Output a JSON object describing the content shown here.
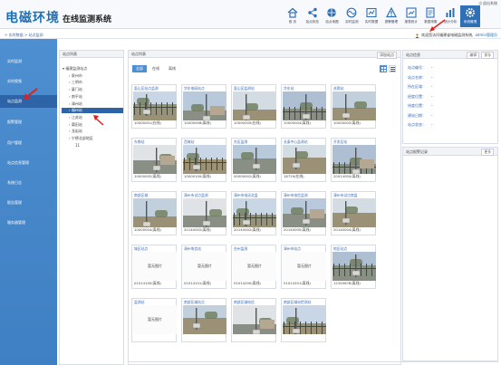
{
  "app": {
    "logo": "电磁环境",
    "logo_sub": "在线监测系统",
    "top_link": "退出系统",
    "breadcrumb": "> 实时数据 > 站点监测",
    "welcome": "欢迎您访问福建省电磁监测系统,",
    "username": "admin管理员"
  },
  "toolbar": [
    {
      "label": "首 页",
      "icon": "home-icon"
    },
    {
      "label": "站点状态",
      "icon": "share-icon"
    },
    {
      "label": "站点地图",
      "icon": "globe-icon"
    },
    {
      "label": "实时监测",
      "icon": "wave-icon"
    },
    {
      "label": "实时数据",
      "icon": "gauge-icon"
    },
    {
      "label": "报警管理",
      "icon": "alert-icon"
    },
    {
      "label": "报表统计",
      "icon": "chart-icon"
    },
    {
      "label": "数据采集",
      "icon": "doc-icon"
    },
    {
      "label": "统计分析",
      "icon": "bar-icon"
    },
    {
      "label": "系统管理",
      "icon": "gear-icon"
    }
  ],
  "sidebar": [
    {
      "label": "实时监测"
    },
    {
      "label": "实时视频"
    },
    {
      "label": "站点监测"
    },
    {
      "label": "报警管理"
    },
    {
      "label": "用户管理"
    },
    {
      "label": "站点信息管理"
    },
    {
      "label": "系统日志"
    },
    {
      "label": "报告管理"
    },
    {
      "label": "服务器管理"
    }
  ],
  "tree": {
    "header": "站点列表",
    "nodes": [
      {
        "label": "▾ 福建监测站点"
      },
      {
        "label": "› 泉州市"
      },
      {
        "label": "› 三明市"
      },
      {
        "label": "› 厦门站"
      },
      {
        "label": "› 南平站"
      },
      {
        "label": "› 漳州站"
      },
      {
        "label": "› 福州站"
      },
      {
        "label": "› 江苏站"
      },
      {
        "label": "› 莆田站"
      },
      {
        "label": "› 龙岩站"
      },
      {
        "label": "› 宁德北部地区"
      },
      {
        "label": "11"
      }
    ]
  },
  "main": {
    "title": "站点列表",
    "add_label": "添加站点",
    "tabs": [
      "全部",
      "在线",
      "离线"
    ],
    "no_image": "暂无图片",
    "cards": [
      {
        "title": "惠山区站点监测",
        "code": "10000001(在线)",
        "img": 0
      },
      {
        "title": "华东电网站点",
        "code": "10000006(离线)",
        "img": 1
      },
      {
        "title": "惠山区监测站",
        "code": "10000005(在线)",
        "img": 2
      },
      {
        "title": "华东站",
        "code": "10000004(离线)",
        "img": 3
      },
      {
        "title": "苏滁站",
        "code": "10000003(离线)",
        "img": 4
      },
      {
        "title": "东南站",
        "code": "10000002(离线)",
        "img": 5
      },
      {
        "title": "西城站",
        "code": "10000100(离线)",
        "img": 6
      },
      {
        "title": "东区监测",
        "code": "00000002(离线)",
        "img": 7
      },
      {
        "title": "长泰中心监测站",
        "code": "18729(在线)",
        "img": 8
      },
      {
        "title": "开发区站",
        "code": "20014004(离线)",
        "img": 9
      },
      {
        "title": "南部区域",
        "code": "10000004(离线)",
        "img": 10
      },
      {
        "title": "漳州市试点监测",
        "code": "20140002(离线)",
        "img": 11
      },
      {
        "title": "漳州市电动北监",
        "code": "20140002(离线)",
        "img": 12
      },
      {
        "title": "漳州市电信监测",
        "code": "20140005(离线)",
        "img": 13
      },
      {
        "title": "漳州市试点南监",
        "code": "20140004(离线)",
        "img": 14
      },
      {
        "title": "城区站点",
        "code": "01014100(离线)",
        "img": -1
      },
      {
        "title": "漳州电信站",
        "code": "01014101(离线)",
        "img": -1
      },
      {
        "title": "台州监测",
        "code": "01014200(离线)",
        "img": -1
      },
      {
        "title": "漳州市站点",
        "code": "01014201(离线)",
        "img": -1
      },
      {
        "title": "地区站点",
        "code": "12345678(离线)",
        "img": 15
      },
      {
        "title": "监测站",
        "code": "",
        "img": -1
      },
      {
        "title": "南部区域站点",
        "code": "",
        "img": 16
      },
      {
        "title": "南部区域电信",
        "code": "",
        "img": 17
      },
      {
        "title": "南部区域站检测站",
        "code": "",
        "img": 18
      }
    ]
  },
  "site_info": {
    "title": "站点信息",
    "edit_label": "编辑",
    "save_label": "保存",
    "rows": [
      {
        "label": "站点编号：",
        "value": "-"
      },
      {
        "label": "站点名称：",
        "value": "-"
      },
      {
        "label": "所在区域：",
        "value": "-"
      },
      {
        "label": "经度位置：",
        "value": "-"
      },
      {
        "label": "纬度位置：",
        "value": "-"
      },
      {
        "label": "建站日期：",
        "value": "-"
      },
      {
        "label": "站点状态：",
        "value": "-"
      }
    ]
  },
  "site_alarm": {
    "title": "站点报警记录",
    "more_label": "更多"
  },
  "colors": {
    "brand": "#1c6fb8",
    "sidebar": "#4d8fd0",
    "active": "#2d64a8",
    "annotation": "#e0201c"
  }
}
